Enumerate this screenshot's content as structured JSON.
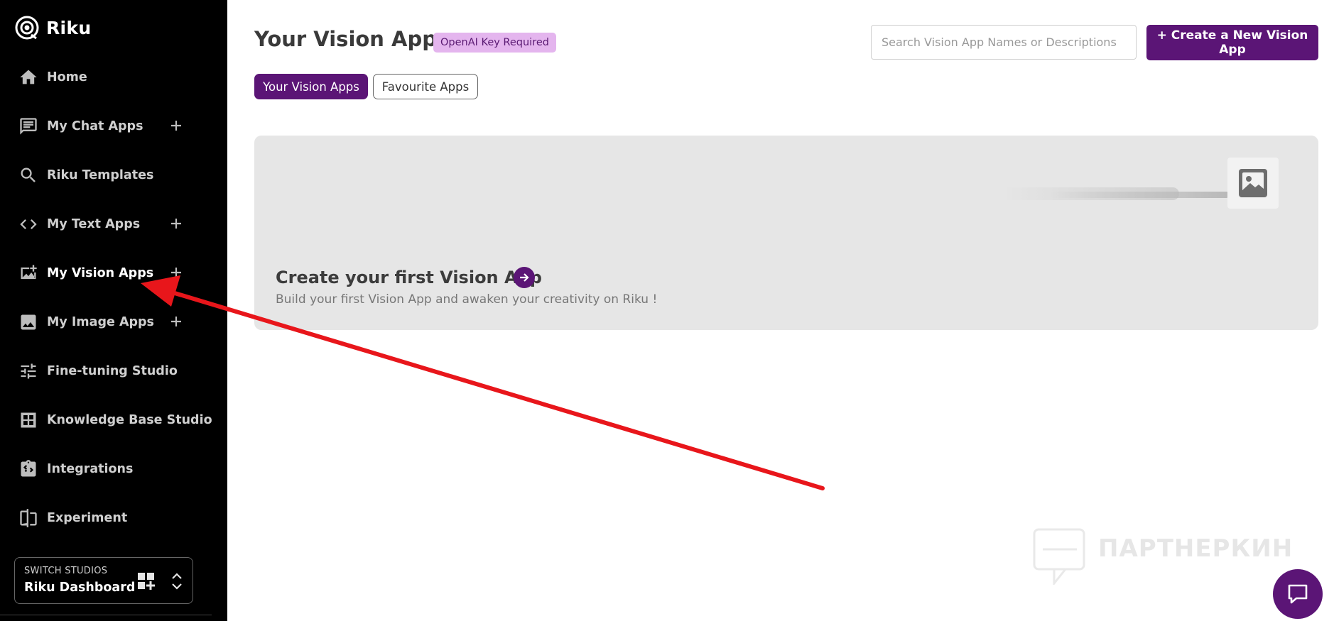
{
  "brand": {
    "name": "Riku"
  },
  "sidebar": {
    "items": [
      {
        "label": "Home",
        "icon": "home-icon",
        "has_add": false
      },
      {
        "label": "My Chat Apps",
        "icon": "chat-icon",
        "has_add": true
      },
      {
        "label": "Riku Templates",
        "icon": "search-icon",
        "has_add": false
      },
      {
        "label": "My Text Apps",
        "icon": "code-icon",
        "has_add": true
      },
      {
        "label": "My Vision Apps",
        "icon": "vision-icon",
        "has_add": true,
        "active": true
      },
      {
        "label": "My Image Apps",
        "icon": "image-icon",
        "has_add": true
      },
      {
        "label": "Fine-tuning Studio",
        "icon": "sliders-icon",
        "has_add": false
      },
      {
        "label": "Knowledge Base Studio",
        "icon": "grid-icon",
        "has_add": false
      },
      {
        "label": "Integrations",
        "icon": "integrations-icon",
        "has_add": false
      },
      {
        "label": "Experiment",
        "icon": "experiment-icon",
        "has_add": false
      }
    ],
    "studio_switch": {
      "caption": "SWITCH STUDIOS",
      "current": "Riku Dashboard"
    }
  },
  "header": {
    "title": "Your Vision Apps",
    "badge": "OpenAI Key Required",
    "search_placeholder": "Search Vision App Names or Descriptions",
    "create_button": "+ Create a New Vision App"
  },
  "tabs": [
    {
      "label": "Your Vision Apps",
      "active": true
    },
    {
      "label": "Favourite Apps",
      "active": false
    }
  ],
  "empty_card": {
    "title": "Create your first Vision App",
    "subtitle": "Build your first Vision App and awaken your creativity on Riku !"
  },
  "watermark": {
    "text": "ПАРТНЕРКИН"
  },
  "colors": {
    "sidebar_bg": "#000000",
    "accent": "#5b1576",
    "badge_bg": "#e4b5ee",
    "card_bg": "#e6e6e6",
    "annotation_arrow": "#e8161b"
  }
}
